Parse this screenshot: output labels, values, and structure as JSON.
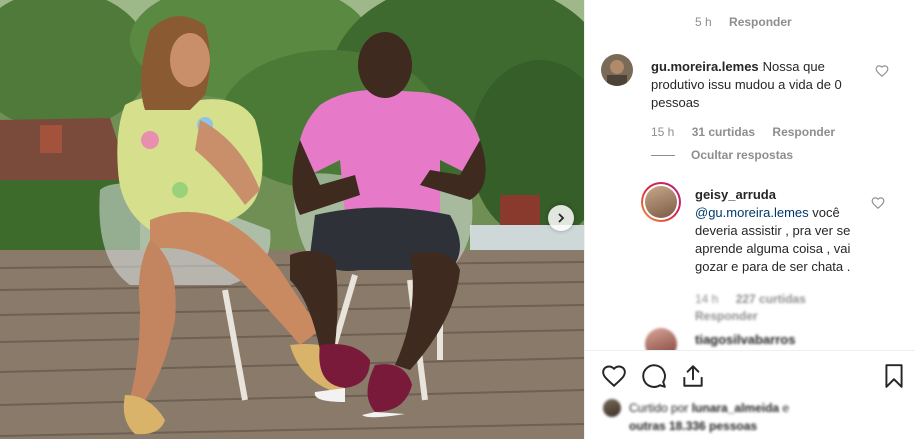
{
  "post": {
    "slide_next": "chevron-right-icon"
  },
  "top_comment_meta": {
    "time": "5 h",
    "reply": "Responder"
  },
  "comment": {
    "username": "gu.moreira.lemes",
    "text": "Nossa que produtivo issu mudou a vida de 0 pessoas",
    "time": "15 h",
    "likes": "31 curtidas",
    "reply": "Responder",
    "hide_replies": "Ocultar respostas"
  },
  "replies": [
    {
      "username": "geisy_arruda",
      "mention": "@gu.moreira.lemes",
      "text": " você deveria assistir , pra ver se aprende alguma coisa , vai gozar e para de ser chata .",
      "time": "14 h",
      "likes": "227 curtidas",
      "reply": "Responder"
    },
    {
      "username": "tiagosilvabarros"
    }
  ],
  "liked_by": {
    "prefix": "Curtido por ",
    "user": "lunara_almeida",
    "middle": " e",
    "others": "outras 18.336 pessoas"
  },
  "colors": {
    "text": "#262626",
    "muted": "#8e8e8e",
    "mention": "#00376b",
    "border": "#efefef"
  }
}
